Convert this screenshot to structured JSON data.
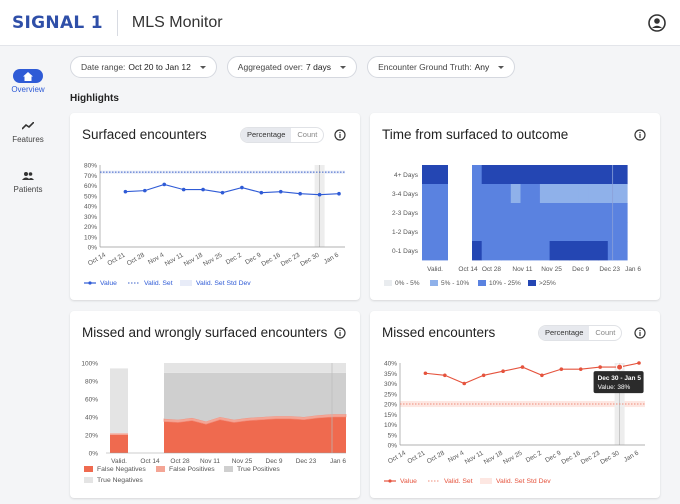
{
  "brand": "SIGNAL 1",
  "app_title": "MLS Monitor",
  "nav": [
    {
      "label": "Overview",
      "icon": "home-icon"
    },
    {
      "label": "Features",
      "icon": "trend-icon"
    },
    {
      "label": "Patients",
      "icon": "people-icon"
    }
  ],
  "filters": [
    {
      "label": "Date range:",
      "value": "Oct 20 to Jan 12"
    },
    {
      "label": "Aggregated over:",
      "value": "7 days"
    },
    {
      "label": "Encounter Ground Truth:",
      "value": "Any"
    }
  ],
  "section_title": "Highlights",
  "toggle": {
    "percentage": "Percentage",
    "count": "Count"
  },
  "cards": {
    "surfaced": {
      "title": "Surfaced encounters",
      "legend": [
        "Value",
        "Valid. Set",
        "Valid. Set Std Dev"
      ]
    },
    "time": {
      "title": "Time from surfaced to outcome",
      "legend": [
        "0% - 5%",
        "5% - 10%",
        "10% - 25%",
        ">25%"
      ]
    },
    "missed_wrong": {
      "title": "Missed and wrongly surfaced encounters",
      "legend": [
        "False Negatives",
        "False Positives",
        "True Positives",
        "True Negatives"
      ]
    },
    "missed": {
      "title": "Missed encounters",
      "legend": [
        "Value",
        "Valid. Set",
        "Valid. Set Std Dev"
      ],
      "tooltip": {
        "range": "Dec 30 - Jan 5",
        "value": "Value: 38%"
      }
    }
  },
  "chart_data": [
    {
      "type": "line",
      "title": "Surfaced encounters",
      "x": [
        "Oct 14",
        "Oct 21",
        "Oct 28",
        "Nov 4",
        "Nov 11",
        "Nov 18",
        "Nov 25",
        "Dec 2",
        "Dec 9",
        "Dec 16",
        "Dec 23",
        "Dec 30",
        "Jan 6"
      ],
      "series": [
        {
          "name": "Value",
          "values": [
            null,
            54,
            55,
            61,
            56,
            56,
            53,
            58,
            53,
            54,
            52,
            51,
            52
          ]
        },
        {
          "name": "Valid. Set",
          "values": [
            73,
            73,
            73,
            73,
            73,
            73,
            73,
            73,
            73,
            73,
            73,
            73,
            73
          ]
        }
      ],
      "yticks": [
        "0%",
        "10%",
        "20%",
        "30%",
        "40%",
        "50%",
        "60%",
        "70%",
        "80%"
      ],
      "ylim": [
        0,
        80
      ]
    },
    {
      "type": "heatmap",
      "title": "Time from surfaced to outcome",
      "y_categories": [
        "4+ Days",
        "3-4 Days",
        "2-3 Days",
        "1-2 Days",
        "0-1 Days"
      ],
      "x_labels": [
        "Valid.",
        "Oct 14",
        "Oct 28",
        "Nov 11",
        "Nov 25",
        "Dec 9",
        "Dec 23",
        "Jan 6"
      ],
      "bins": [
        "0% - 5%",
        "5% - 10%",
        "10% - 25%",
        ">25%"
      ],
      "cells": [
        [
          3,
          null,
          2,
          3,
          3,
          3,
          3,
          3,
          3,
          3,
          3,
          3,
          3,
          3,
          3,
          3,
          3,
          3
        ],
        [
          2,
          null,
          2,
          2,
          2,
          2,
          1,
          2,
          2,
          1,
          1,
          1,
          1,
          1,
          1,
          1,
          1,
          1
        ],
        [
          2,
          null,
          2,
          2,
          2,
          2,
          2,
          2,
          2,
          2,
          2,
          2,
          2,
          2,
          2,
          2,
          2,
          2
        ],
        [
          2,
          null,
          2,
          2,
          2,
          2,
          2,
          2,
          2,
          2,
          2,
          2,
          2,
          2,
          2,
          2,
          2,
          2
        ],
        [
          2,
          null,
          3,
          2,
          2,
          2,
          2,
          2,
          2,
          2,
          3,
          3,
          3,
          3,
          3,
          3,
          2,
          2
        ]
      ]
    },
    {
      "type": "area",
      "title": "Missed and wrongly surfaced encounters",
      "x_labels": [
        "Valid.",
        "Oct 14",
        "Oct 28",
        "Nov 11",
        "Nov 25",
        "Dec 9",
        "Dec 23",
        "Jan 6"
      ],
      "yticks": [
        "0%",
        "20%",
        "40%",
        "60%",
        "80%",
        "100%"
      ],
      "ylim": [
        0,
        100
      ],
      "series": [
        {
          "name": "False Negatives",
          "valid": 20,
          "values": [
            35,
            34,
            36,
            32,
            37,
            34,
            36,
            37,
            38,
            38,
            37,
            39,
            40,
            40
          ]
        },
        {
          "name": "False Positives",
          "valid": 2,
          "values": [
            3,
            3,
            3,
            3,
            3,
            3,
            3,
            3,
            3,
            3,
            3,
            3,
            3,
            3
          ]
        },
        {
          "name": "True Positives",
          "valid": 0,
          "values": [
            51,
            52,
            50,
            54,
            49,
            52,
            50,
            49,
            48,
            48,
            49,
            47,
            46,
            46
          ]
        },
        {
          "name": "True Negatives",
          "valid": 72,
          "values": [
            11,
            11,
            11,
            11,
            11,
            11,
            11,
            11,
            11,
            11,
            11,
            11,
            11,
            11
          ]
        }
      ]
    },
    {
      "type": "line",
      "title": "Missed encounters",
      "x": [
        "Oct 14",
        "Oct 21",
        "Oct 28",
        "Nov 4",
        "Nov 11",
        "Nov 18",
        "Nov 25",
        "Dec 2",
        "Dec 9",
        "Dec 16",
        "Dec 23",
        "Dec 30",
        "Jan 6"
      ],
      "series": [
        {
          "name": "Value",
          "values": [
            null,
            35,
            34,
            30,
            34,
            36,
            38,
            34,
            37,
            37,
            38,
            38,
            40
          ]
        },
        {
          "name": "Valid. Set",
          "values": [
            20,
            20,
            20,
            20,
            20,
            20,
            20,
            20,
            20,
            20,
            20,
            20,
            20
          ]
        }
      ],
      "yticks": [
        "0%",
        "5%",
        "10%",
        "15%",
        "20%",
        "25%",
        "30%",
        "35%",
        "40%"
      ],
      "ylim": [
        0,
        40
      ]
    }
  ]
}
